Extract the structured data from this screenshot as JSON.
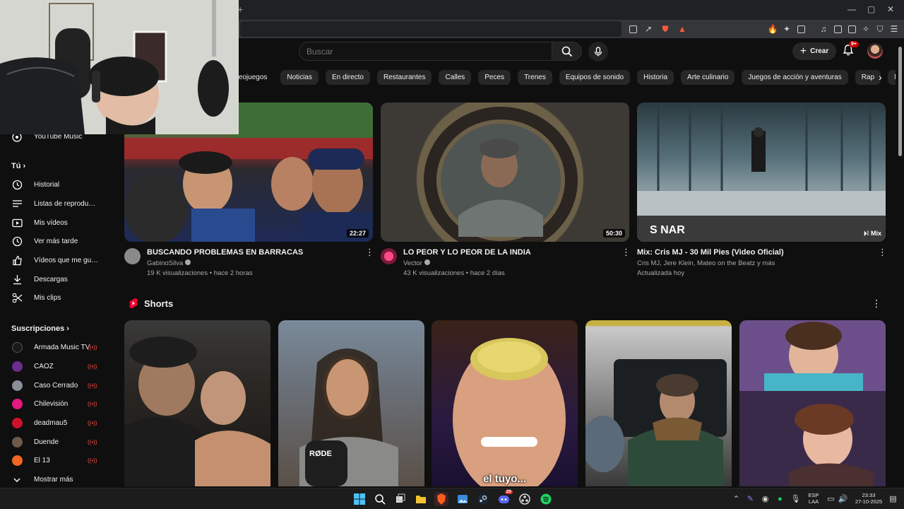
{
  "browser": {
    "new_tab": "+",
    "window_controls": [
      "—",
      "▢",
      "✕"
    ],
    "extensions": [
      "cast-icon",
      "share-icon",
      "brave-shield-icon",
      "brave-rewards-icon",
      "fire-icon",
      "puzzle-icon",
      "screenshot-icon",
      "music-icon",
      "sidebar-icon",
      "wallet-icon",
      "ai-icon",
      "vpn-icon",
      "menu-icon"
    ]
  },
  "search": {
    "placeholder": "Buscar"
  },
  "header": {
    "create_label": "Crear",
    "notifications_badge": "9+"
  },
  "chips": [
    "ideojuegos",
    "Noticias",
    "En directo",
    "Restaurantes",
    "Calles",
    "Peces",
    "Trenes",
    "Equipos de sonido",
    "Historia",
    "Arte culinario",
    "Juegos de acción y aventuras",
    "Rap",
    "Música pop"
  ],
  "sidebar": {
    "youtube_music": "YouTube Music",
    "you_heading": "Tú",
    "you_items": [
      {
        "icon": "history-icon",
        "label": "Historial"
      },
      {
        "icon": "playlist-icon",
        "label": "Listas de reproducc..."
      },
      {
        "icon": "my-videos-icon",
        "label": "Mis vídeos"
      },
      {
        "icon": "watch-later-icon",
        "label": "Ver más tarde"
      },
      {
        "icon": "liked-icon",
        "label": "Vídeos que me gus..."
      },
      {
        "icon": "download-icon",
        "label": "Descargas"
      },
      {
        "icon": "scissors-icon",
        "label": "Mis clips"
      }
    ],
    "subs_heading": "Suscripciones",
    "subscriptions": [
      {
        "label": "Armada Music TV",
        "color": "#1a1a1a"
      },
      {
        "label": "CAOZ",
        "color": "#6b2d8f"
      },
      {
        "label": "Caso Cerrado",
        "color": "#8a8f99"
      },
      {
        "label": "Chilevisión",
        "color": "#e5197f"
      },
      {
        "label": "deadmau5",
        "color": "#d0112b"
      },
      {
        "label": "Duende",
        "color": "#6e5a4a"
      },
      {
        "label": "El 13",
        "color": "#f26522"
      }
    ],
    "show_more": "Mostrar más"
  },
  "videos": [
    {
      "title": "BUSCANDO PROBLEMAS EN BARRACAS",
      "channel": "GabinoSilva",
      "verified": true,
      "views": "19 K visualizaciones",
      "age": "hace 2 horas",
      "duration": "22:27"
    },
    {
      "title": "LO PEOR Y LO PEOR DE LA INDIA",
      "channel": "Vector",
      "verified": true,
      "views": "43 K visualizaciones",
      "age": "hace 2 días",
      "duration": "50:30"
    },
    {
      "title": "Mix: Cris MJ - 30 Mil Pies (Video Oficial)",
      "channel": "Cris MJ, Jere Klein, Mateo on the Beatz y más",
      "verified": false,
      "views": "Actualizada hoy",
      "age": "",
      "duration": "Mix",
      "overlay_text": "S  NAR"
    }
  ],
  "shorts": {
    "heading": "Shorts",
    "items": [
      {
        "caption": ""
      },
      {
        "caption": "",
        "mic_text": "RØDE"
      },
      {
        "caption": "el tuyo..."
      },
      {
        "caption": ""
      },
      {
        "caption": ""
      }
    ]
  },
  "taskbar": {
    "language": "ESP",
    "layout": "LAA",
    "time": "23:33",
    "date": "27-10-2025",
    "discord_badge": "20"
  }
}
